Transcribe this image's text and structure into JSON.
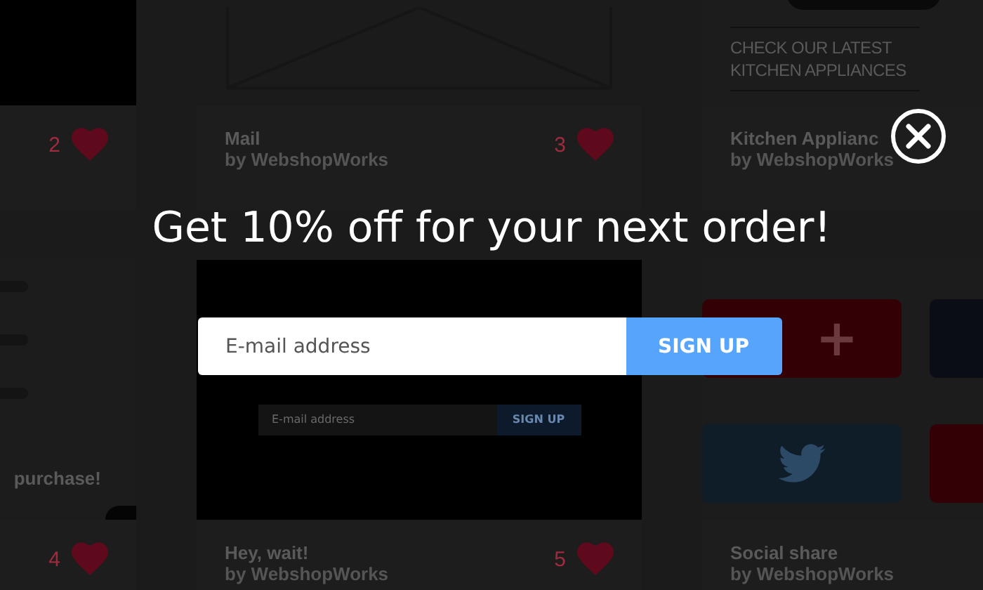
{
  "gallery": {
    "cards": [
      {
        "kind": "dark",
        "likes": "2"
      },
      {
        "kind": "envelope",
        "title": "Mail",
        "author": "by WebshopWorks",
        "likes": "3"
      },
      {
        "kind": "kitchen",
        "caption": "CHECK OUR LATEST KITCHEN APPLIANCES",
        "title": "Kitchen Applianc",
        "author": "by WebshopWorks"
      },
      {
        "kind": "shelf",
        "caption": "purchase!",
        "likes": "4"
      },
      {
        "kind": "popup",
        "field_placeholder": "E-mail address",
        "button": "SIGN UP",
        "title": "Hey, wait!",
        "author": "by WebshopWorks",
        "likes": "5"
      },
      {
        "kind": "social",
        "tile_label": "+",
        "title": "Social share",
        "author": "by WebshopWorks"
      }
    ]
  },
  "popup": {
    "title": "Get 10% off for your next order!",
    "email": {
      "placeholder": "E-mail address"
    },
    "button": "SIGN UP"
  }
}
